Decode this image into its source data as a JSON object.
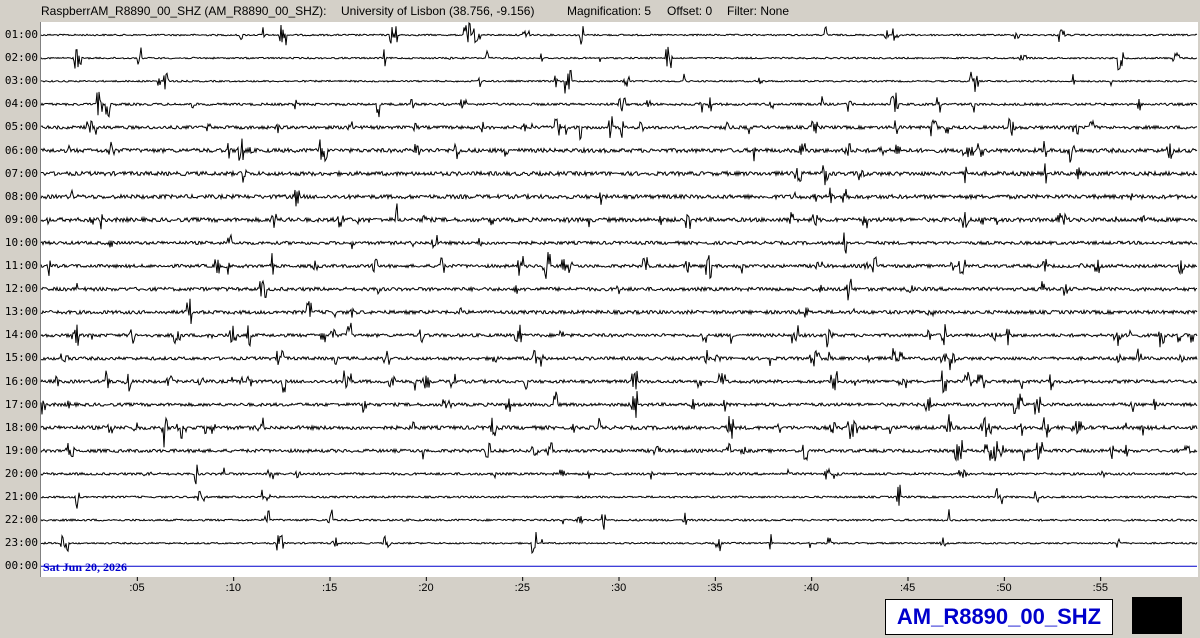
{
  "header": {
    "station_title": "RaspberrAM_R8890_00_SHZ (AM_R8890_00_SHZ):",
    "location": "University of Lisbon (38.756, -9.156)",
    "magnification": "Magnification: 5",
    "offset": "Offset: 0",
    "filter": "Filter: None"
  },
  "footer": {
    "date": "Sat Jun 20, 2026",
    "station_code": "AM_R8890_00_SHZ"
  },
  "chart_data": {
    "type": "helicorder",
    "y_tick_labels": [
      "01:00",
      "02:00",
      "03:00",
      "04:00",
      "05:00",
      "06:00",
      "07:00",
      "08:00",
      "09:00",
      "10:00",
      "11:00",
      "12:00",
      "13:00",
      "14:00",
      "15:00",
      "16:00",
      "17:00",
      "18:00",
      "19:00",
      "20:00",
      "21:00",
      "22:00",
      "23:00",
      "00:00"
    ],
    "x_tick_labels": [
      ":05",
      ":10",
      ":15",
      ":20",
      ":25",
      ":30",
      ":35",
      ":40",
      ":45",
      ":50",
      ":55"
    ],
    "x_ticks_minutes": [
      5,
      10,
      15,
      20,
      25,
      30,
      35,
      40,
      45,
      50,
      55
    ],
    "xlim_minutes": [
      0,
      60
    ],
    "trace_noise_level": [
      1,
      1,
      1,
      1.5,
      2,
      2.5,
      2.5,
      2.5,
      2.5,
      2,
      2,
      2.2,
      2.2,
      2,
      2,
      2,
      2,
      2.3,
      2,
      1.5,
      1.2,
      1.2,
      1,
      0
    ],
    "trace_color": "#000000",
    "current_line_color": "#0000cc"
  }
}
